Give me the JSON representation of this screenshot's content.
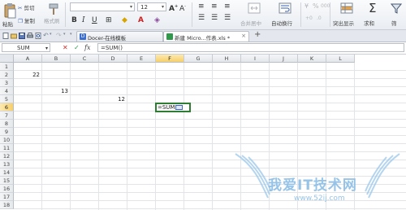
{
  "toolbar": {
    "cut_label": "剪切",
    "paste_label": "粘贴",
    "copy_label": "复制",
    "format_painter_label": "格式刷",
    "font_size": "12",
    "bold": "B",
    "italic": "I",
    "underline": "U",
    "merge_center_label": "合并居中",
    "wrap_text_label": "自动换行",
    "percent": "%",
    "thousands": "000",
    "highlight_label": "突出显示",
    "sum_label": "求和",
    "filter_label": "筛"
  },
  "tabs": [
    {
      "label": "Docer-在线模板"
    },
    {
      "label": "新建 Micro...作表.xls *"
    }
  ],
  "new_tab": "+",
  "formula_bar": {
    "name_box": "SUM",
    "cancel": "✕",
    "confirm": "✓",
    "fx": "fx",
    "formula": "=SUM()"
  },
  "sheet": {
    "columns": [
      "A",
      "B",
      "C",
      "D",
      "E",
      "F",
      "G",
      "H",
      "I",
      "J",
      "K",
      "L"
    ],
    "selected_column": "F",
    "rows": [
      "1",
      "2",
      "3",
      "4",
      "5",
      "6",
      "7",
      "8",
      "9",
      "10",
      "11",
      "12",
      "13",
      "14",
      "15",
      "16",
      "17",
      "18"
    ],
    "selected_row": "6",
    "cells": [
      {
        "ref": "A2",
        "value": "22"
      },
      {
        "ref": "B4",
        "value": "13"
      },
      {
        "ref": "D5",
        "value": "12"
      }
    ],
    "active_cell": {
      "ref": "F6",
      "text": "=SUM"
    }
  },
  "colors": {
    "selection": "#2e7d32",
    "header_highlight": "#f6cf6a",
    "watermark": "#8bbde6"
  },
  "watermark": {
    "title": "我爱IT技术网",
    "url": "www.52ij.com"
  }
}
